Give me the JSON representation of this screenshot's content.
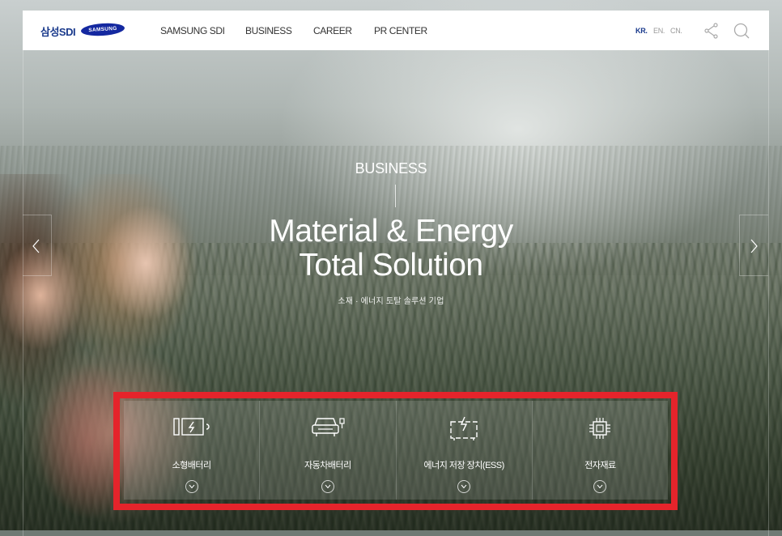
{
  "header": {
    "logo_text": "삼성SDI",
    "brand_logo_text": "SAMSUNG",
    "nav": [
      {
        "label": "SAMSUNG SDI"
      },
      {
        "label": "BUSINESS"
      },
      {
        "label": "CAREER"
      },
      {
        "label": "PR CENTER"
      }
    ],
    "languages": [
      {
        "label": "KR.",
        "active": true
      },
      {
        "label": "EN."
      },
      {
        "label": "CN."
      }
    ],
    "icons": [
      "share-icon",
      "search-icon"
    ]
  },
  "hero": {
    "kicker": "BUSINESS",
    "headline_line1": "Material & Energy",
    "headline_line2": "Total Solution",
    "subline": "소재 · 에너지 토탈 솔루션 기업",
    "arrows": [
      "chevron-left-icon",
      "chevron-right-icon"
    ]
  },
  "categories": [
    {
      "label": "소형배터리",
      "icon": "small-battery-icon"
    },
    {
      "label": "자동차배터리",
      "icon": "car-battery-icon"
    },
    {
      "label": "에너지 저장 장치(ESS)",
      "icon": "energy-storage-icon"
    },
    {
      "label": "전자재료",
      "icon": "chip-icon"
    }
  ],
  "colors": {
    "brand_blue": "#1428a0",
    "highlight_red": "#e5242b",
    "header_bg": "#ffffff"
  }
}
